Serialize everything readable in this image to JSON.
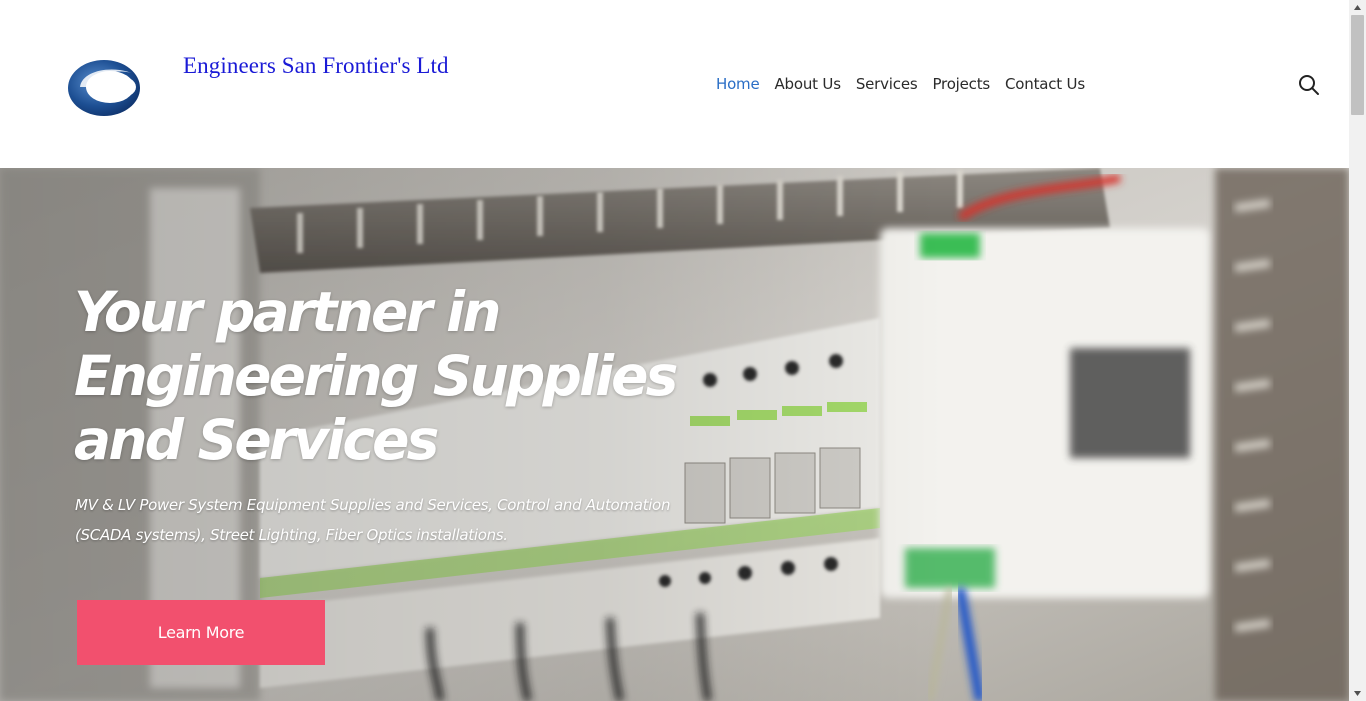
{
  "brand": {
    "name": "Engineers San Frontier's Ltd"
  },
  "nav": [
    {
      "label": "Home",
      "active": true
    },
    {
      "label": "About Us",
      "active": false
    },
    {
      "label": "Services",
      "active": false
    },
    {
      "label": "Projects",
      "active": false
    },
    {
      "label": "Contact Us",
      "active": false
    }
  ],
  "header": {
    "search_icon": "search-icon"
  },
  "hero": {
    "title_lines": [
      "Your partner in",
      "Engineering Supplies",
      "and Services"
    ],
    "subtitle_lines": [
      "MV & LV Power System Equipment Supplies and Services, Control and Automation",
      "(SCADA systems), Street Lighting, Fiber Optics installations."
    ],
    "button_label": "Learn More",
    "button_color": "#f2506e"
  },
  "colors": {
    "nav_active": "#2a6ec6",
    "brand_text": "#1a1ad6"
  }
}
